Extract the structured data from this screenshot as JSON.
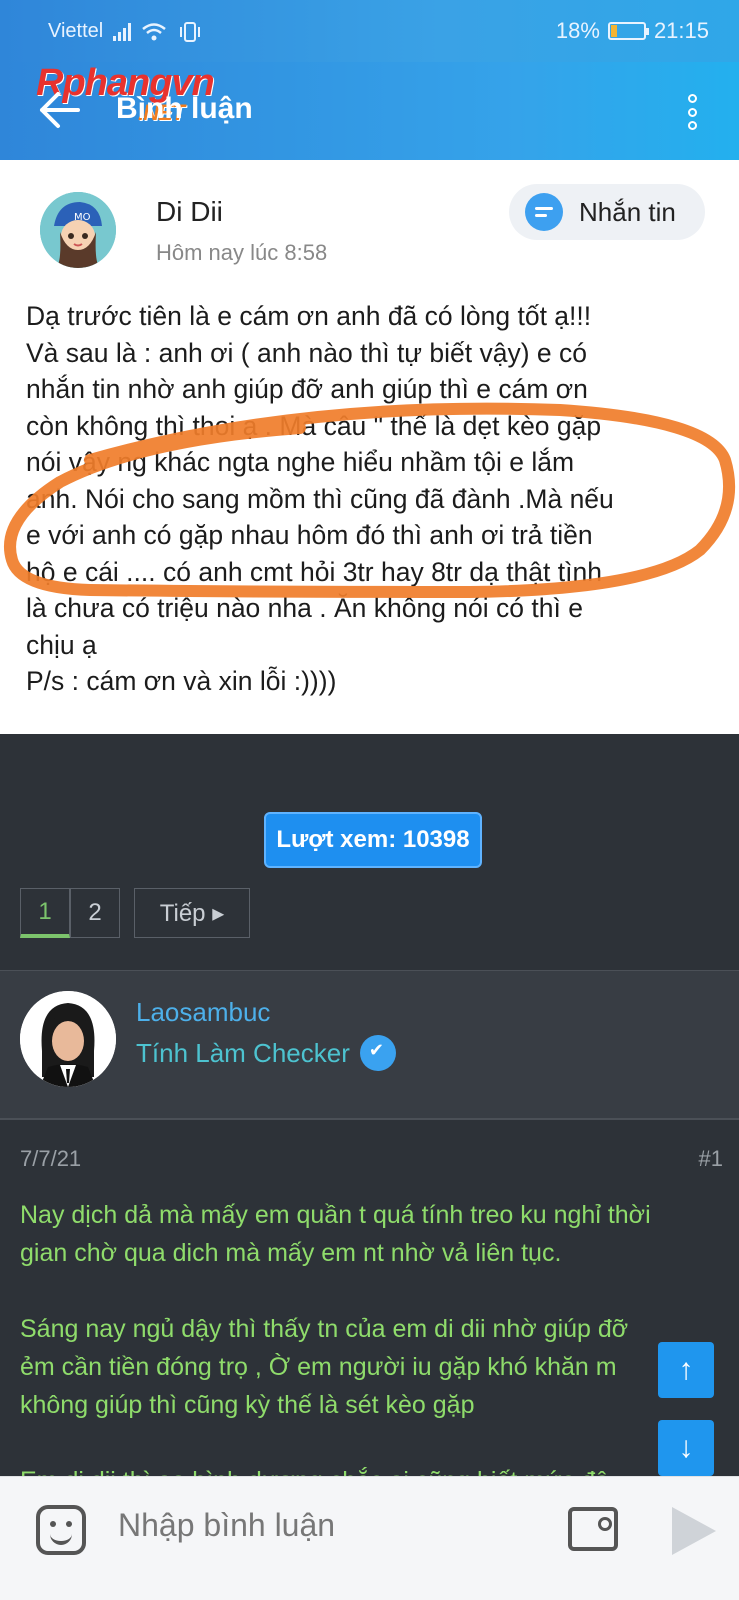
{
  "status_bar": {
    "carrier": "Viettel",
    "battery": "18%",
    "battery_level": 0.18,
    "time": "21:15"
  },
  "app_bar": {
    "logo_text": "Rphangvn",
    "logo_suffix": ".NET",
    "title": "Bình luận"
  },
  "post": {
    "author": "Di Dii",
    "time": "Hôm nay lúc 8:58",
    "message_button": "Nhắn tin",
    "lines": [
      "Dạ trước tiên là e cám ơn anh đã có lòng tốt ạ!!!",
      "Và sau là : anh ơi ( anh nào thì tự biết vậy) e có",
      "nhắn tin nhờ anh giúp đỡ anh giúp thì e cám ơn",
      "còn không thì thoi ạ . Mà câu \" thế là dẹt kèo gặp",
      "nói vậy ng khác ngta nghe hiểu nhầm tội e lắm",
      "anh. Nói cho sang mồm thì cũng đã đành .Mà nếu",
      "e với anh có gặp nhau hôm đó thì anh ơi  trả tiền",
      "hộ e cái .... có anh cmt hỏi 3tr hay 8tr dạ thật tình",
      "là chưa có triệu nào nha . Ăn không nói có thì e",
      "chịu ạ",
      "P/s : cám ơn và xin lỗi :))))"
    ]
  },
  "views_label": "Lượt xem: 10398",
  "pagination": {
    "pages": [
      "1",
      "2"
    ],
    "active": "1",
    "next": "Tiếp ▸"
  },
  "forum_user": {
    "name": "Laosambuc",
    "role": "Tính Làm Checker"
  },
  "forum_post": {
    "date": "7/7/21",
    "number": "#1",
    "paragraphs": [
      [
        "Nay dịch dả mà mấy em quần t quá tính treo ku nghỉ thời",
        "gian chờ qua dich mà mấy em nt nhờ vả liên tục."
      ],
      [
        "Sáng nay ngủ dậy thì thấy tn của em di dii nhờ giúp đỡ",
        "ẻm cần tiền đóng trọ , Ờ em người iu gặp khó khăn m",
        "không giúp thì cũng kỳ thế là sét kèo gặp"
      ],
      [
        "Em di dii thì ae bình dương chắc ai cũng biết mức độ"
      ]
    ]
  },
  "fab": {
    "up": "↑",
    "down": "↓"
  },
  "composer": {
    "placeholder": "Nhập bình luận"
  },
  "colors": {
    "accent": "#2f8fe0",
    "green_text": "#8fdc6b",
    "link_blue": "#4db0ea",
    "scribble": "#f07d2a"
  }
}
